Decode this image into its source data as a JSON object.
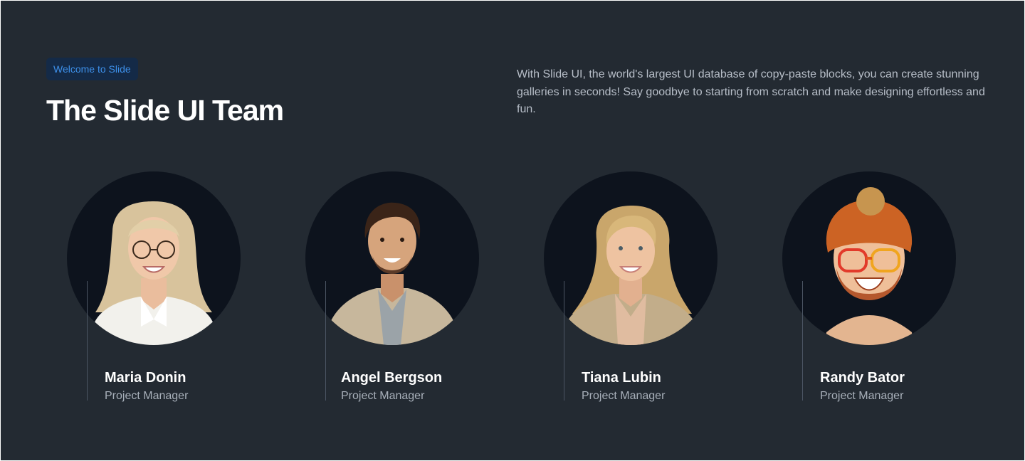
{
  "header": {
    "badge": "Welcome to Slide",
    "title": "The Slide UI Team",
    "description": "With Slide UI, the world's largest UI database of copy-paste blocks, you can create stunning galleries in seconds! Say goodbye to starting from scratch and make designing effortless and fun."
  },
  "team": [
    {
      "name": "Maria Donin",
      "role": "Project Manager",
      "icon": "woman-glasses-portrait"
    },
    {
      "name": "Angel Bergson",
      "role": "Project Manager",
      "icon": "man-jacket-portrait"
    },
    {
      "name": "Tiana Lubin",
      "role": "Project Manager",
      "icon": "woman-blonde-portrait"
    },
    {
      "name": "Randy Bator",
      "role": "Project Manager",
      "icon": "man-beanie-portrait"
    }
  ],
  "colors": {
    "background": "#232a32",
    "badge_background": "#142a47",
    "badge_text": "#3d8fe8",
    "avatar_circle": "#0d131d"
  }
}
